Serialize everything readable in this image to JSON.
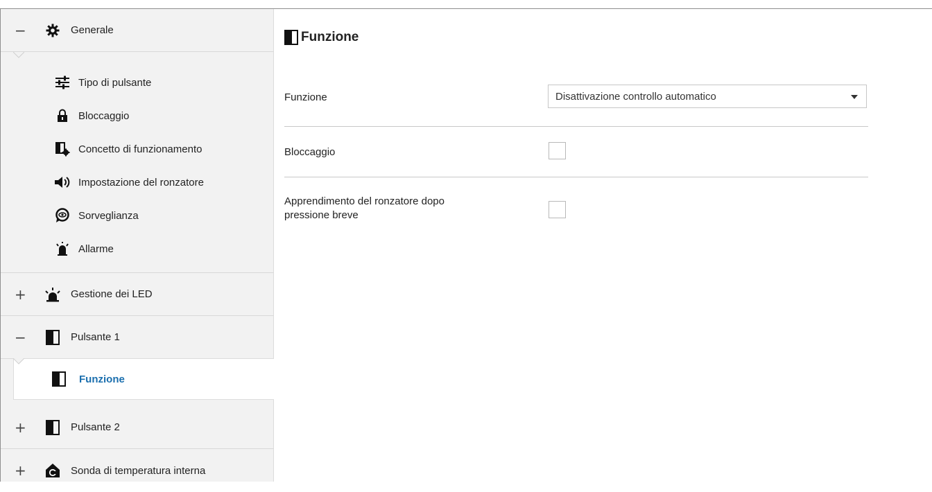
{
  "sidebar": {
    "groups": {
      "generale": {
        "toggle": "−",
        "label": "Generale",
        "icon": "gear-icon"
      },
      "led": {
        "toggle": "+",
        "label": "Gestione dei LED",
        "icon": "led-light-icon"
      },
      "pulsante1": {
        "toggle": "−",
        "label": "Pulsante 1",
        "icon": "button-square-icon"
      },
      "pulsante2": {
        "toggle": "+",
        "label": "Pulsante 2",
        "icon": "button-square-icon"
      },
      "sonda": {
        "toggle": "+",
        "label": "Sonda di temperatura interna",
        "icon": "thermometer-house-icon"
      }
    },
    "generale_items": [
      {
        "label": "Tipo di pulsante",
        "icon": "sliders-icon"
      },
      {
        "label": "Bloccaggio",
        "icon": "lock-icon"
      },
      {
        "label": "Concetto di funzionamento",
        "icon": "button-gear-icon"
      },
      {
        "label": "Impostazione del ronzatore",
        "icon": "speaker-icon"
      },
      {
        "label": "Sorveglianza",
        "icon": "watch-eye-icon"
      },
      {
        "label": "Allarme",
        "icon": "alarm-light-icon"
      }
    ],
    "pulsante1_items": [
      {
        "label": "Funzione",
        "icon": "button-square-icon",
        "selected": true
      }
    ]
  },
  "main": {
    "title": "Funzione",
    "rows": {
      "funzione": {
        "label": "Funzione",
        "value": "Disattivazione controllo automatico"
      },
      "bloccaggio": {
        "label": "Bloccaggio",
        "checked": false
      },
      "apprendimento": {
        "label_line1": "Apprendimento del ronzatore dopo",
        "label_line2": "pressione breve",
        "checked": false
      }
    }
  },
  "colors": {
    "selected_text": "#1b6fae",
    "sidebar_bg": "#f2f2f2",
    "divider": "#c8c8c8"
  }
}
